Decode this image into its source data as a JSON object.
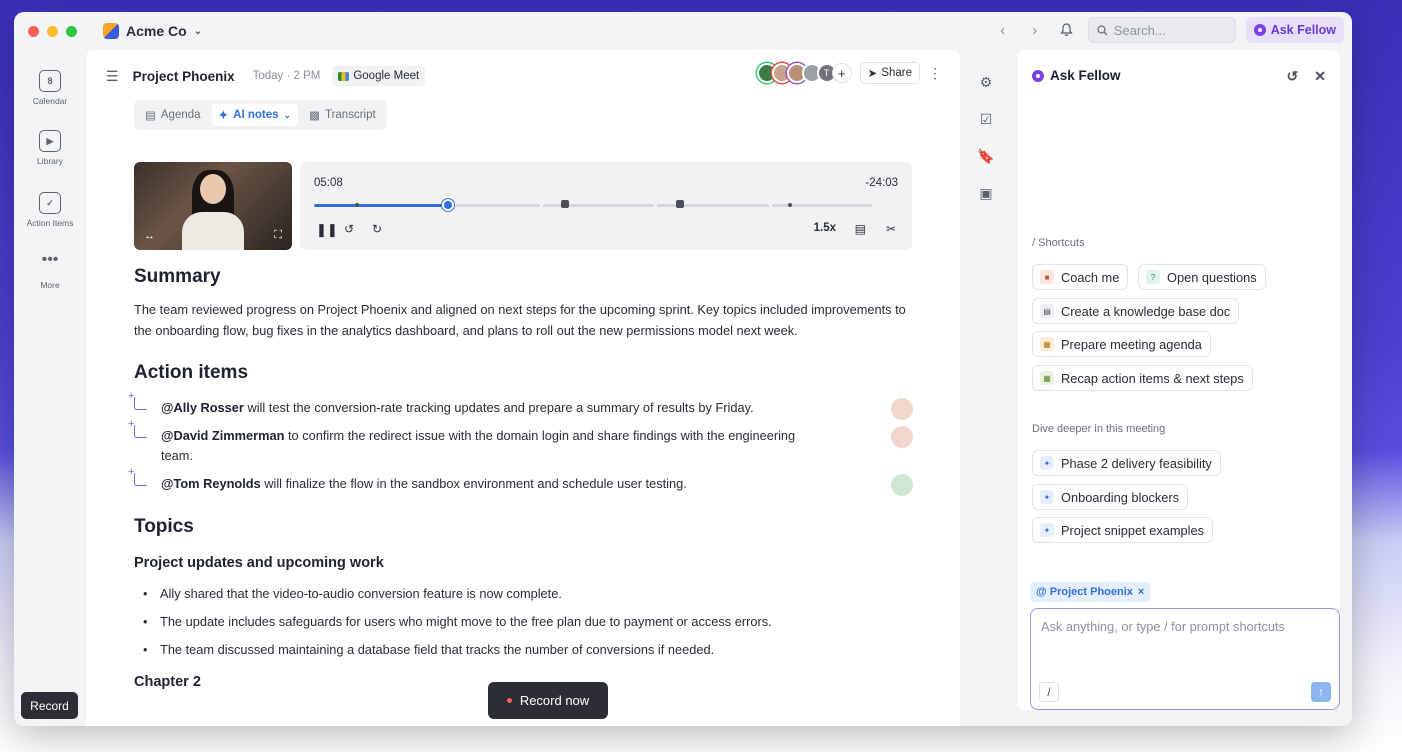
{
  "titlebar": {
    "workspace": "Acme Co",
    "search_placeholder": "Search...",
    "ask_fellow_label": "Ask Fellow"
  },
  "rail": {
    "items": [
      {
        "label": "Calendar",
        "icon": "calendar-icon",
        "badge": "8"
      },
      {
        "label": "Library",
        "icon": "library-icon"
      },
      {
        "label": "Action Items",
        "icon": "checkbox-icon"
      },
      {
        "label": "More",
        "icon": "more-icon"
      }
    ],
    "record_label": "Record"
  },
  "doc": {
    "title": "Project Phoenix",
    "date": "Today · 2 PM",
    "meeting_app": "Google Meet",
    "avatar_initial": "T",
    "share_label": "Share",
    "tabs": [
      {
        "label": "Agenda",
        "active": false
      },
      {
        "label": "AI notes",
        "active": true
      },
      {
        "label": "Transcript",
        "active": false
      }
    ],
    "player": {
      "elapsed": "05:08",
      "remaining": "-24:03",
      "speed": "1.5x",
      "progress": 0.24
    },
    "summary_heading": "Summary",
    "summary_text": "The team reviewed progress on Project Phoenix and aligned on next steps for the upcoming sprint. Key topics included improvements to the onboarding flow, bug fixes in the analytics dashboard, and plans to roll out the new permissions model next week.",
    "action_heading": "Action items",
    "action_items": [
      {
        "assignee": "@Ally Rosser",
        "text": " will test the conversion-rate tracking updates and prepare a summary of results by Friday."
      },
      {
        "assignee": "@David Zimmerman",
        "text": " to confirm the redirect issue with the domain login and share findings with the engineering team."
      },
      {
        "assignee": "@Tom Reynolds",
        "text": " will finalize the flow in the sandbox environment and schedule user testing."
      }
    ],
    "topics_heading": "Topics",
    "topic_subheading": "Project updates and upcoming work",
    "bullets": [
      "Ally shared that the video-to-audio conversion feature is now complete.",
      "The update includes safeguards for users who might move to the free plan due to payment or access errors.",
      "The team discussed maintaining a database field that tracks the number of conversions if needed."
    ],
    "chapter_heading": "Chapter 2",
    "record_now_label": "Record now"
  },
  "panel": {
    "title": "Ask Fellow",
    "shortcuts_label": "/ Shortcuts",
    "shortcuts": [
      {
        "label": "Coach me",
        "icon": "coach-icon"
      },
      {
        "label": "Open questions",
        "icon": "question-icon"
      },
      {
        "label": "Create a knowledge base doc",
        "icon": "doc-icon"
      },
      {
        "label": "Prepare meeting agenda",
        "icon": "agenda-icon"
      },
      {
        "label": "Recap action items & next steps",
        "icon": "recap-icon"
      }
    ],
    "dive_label": "Dive deeper in this meeting",
    "dive_items": [
      {
        "label": "Phase 2 delivery feasibility"
      },
      {
        "label": "Onboarding blockers"
      },
      {
        "label": "Project snippet examples"
      }
    ],
    "context_chip": "@ Project Phoenix",
    "input_placeholder": "Ask anything, or type / for prompt shortcuts",
    "slash_label": "/"
  },
  "colors": {
    "accent_blue": "#2f6fde",
    "fellow_purple": "#7b3fe4",
    "dark": "#2a2f36"
  }
}
